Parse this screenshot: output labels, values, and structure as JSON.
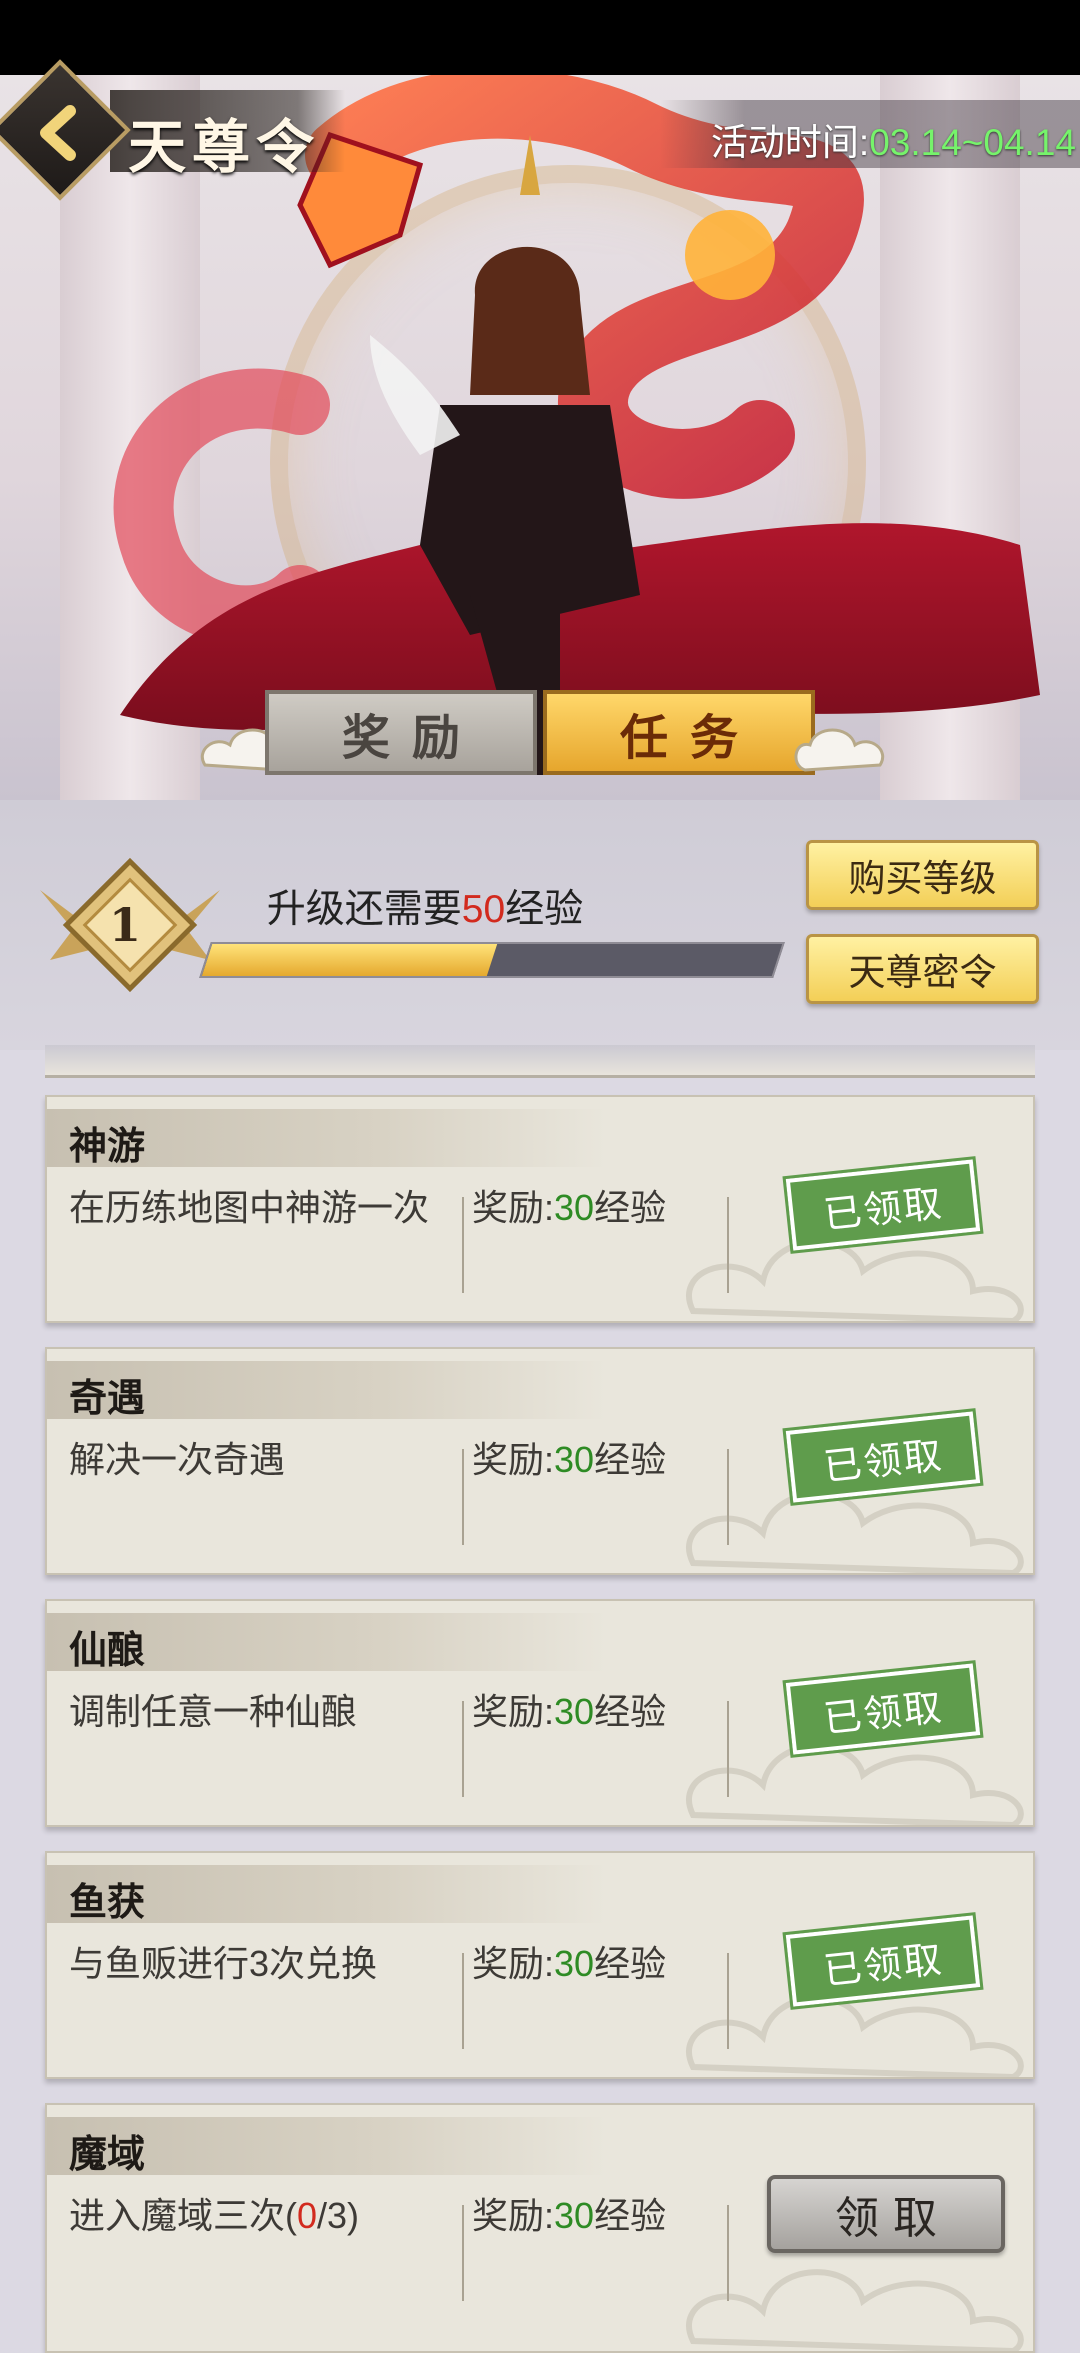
{
  "header": {
    "title": "天尊令",
    "event_label": "活动时间:",
    "event_time": "03.14~04.14"
  },
  "tabs": [
    {
      "label": "奖励",
      "active": false
    },
    {
      "label": "任务",
      "active": true
    }
  ],
  "level": {
    "value": "1",
    "need_prefix": "升级还需要",
    "need_amount": "50",
    "need_suffix": "经验",
    "progress": 0.5
  },
  "buttons": {
    "buy_level": "购买等级",
    "secret_order": "天尊密令"
  },
  "reward_label": "奖励:",
  "reward_unit": "经验",
  "tasks": [
    {
      "name": "神游",
      "desc": "在历练地图中神游一次",
      "desc_progress": "",
      "desc_total": "",
      "reward": "30",
      "status": "已领取"
    },
    {
      "name": "奇遇",
      "desc": "解决一次奇遇",
      "desc_progress": "",
      "desc_total": "",
      "reward": "30",
      "status": "已领取"
    },
    {
      "name": "仙酿",
      "desc": "调制任意一种仙酿",
      "desc_progress": "",
      "desc_total": "",
      "reward": "30",
      "status": "已领取"
    },
    {
      "name": "鱼获",
      "desc": "与鱼贩进行3次兑换",
      "desc_progress": "",
      "desc_total": "",
      "reward": "30",
      "status": "已领取"
    },
    {
      "name": "魔域",
      "desc": "进入魔域三次(",
      "desc_progress": "0",
      "desc_total": "/3)",
      "reward": "30",
      "status": "领取"
    }
  ],
  "colors": {
    "accent_gold": "#f3cf57",
    "claimed_green": "#5f9c4c",
    "reward_green": "#2e8b24",
    "warning_red": "#d22a1e",
    "time_green": "#76f36b"
  },
  "icons": {
    "back": "chevron-left-icon",
    "level_badge": "level-badge-icon",
    "hero": "dragon-warrior-art"
  }
}
